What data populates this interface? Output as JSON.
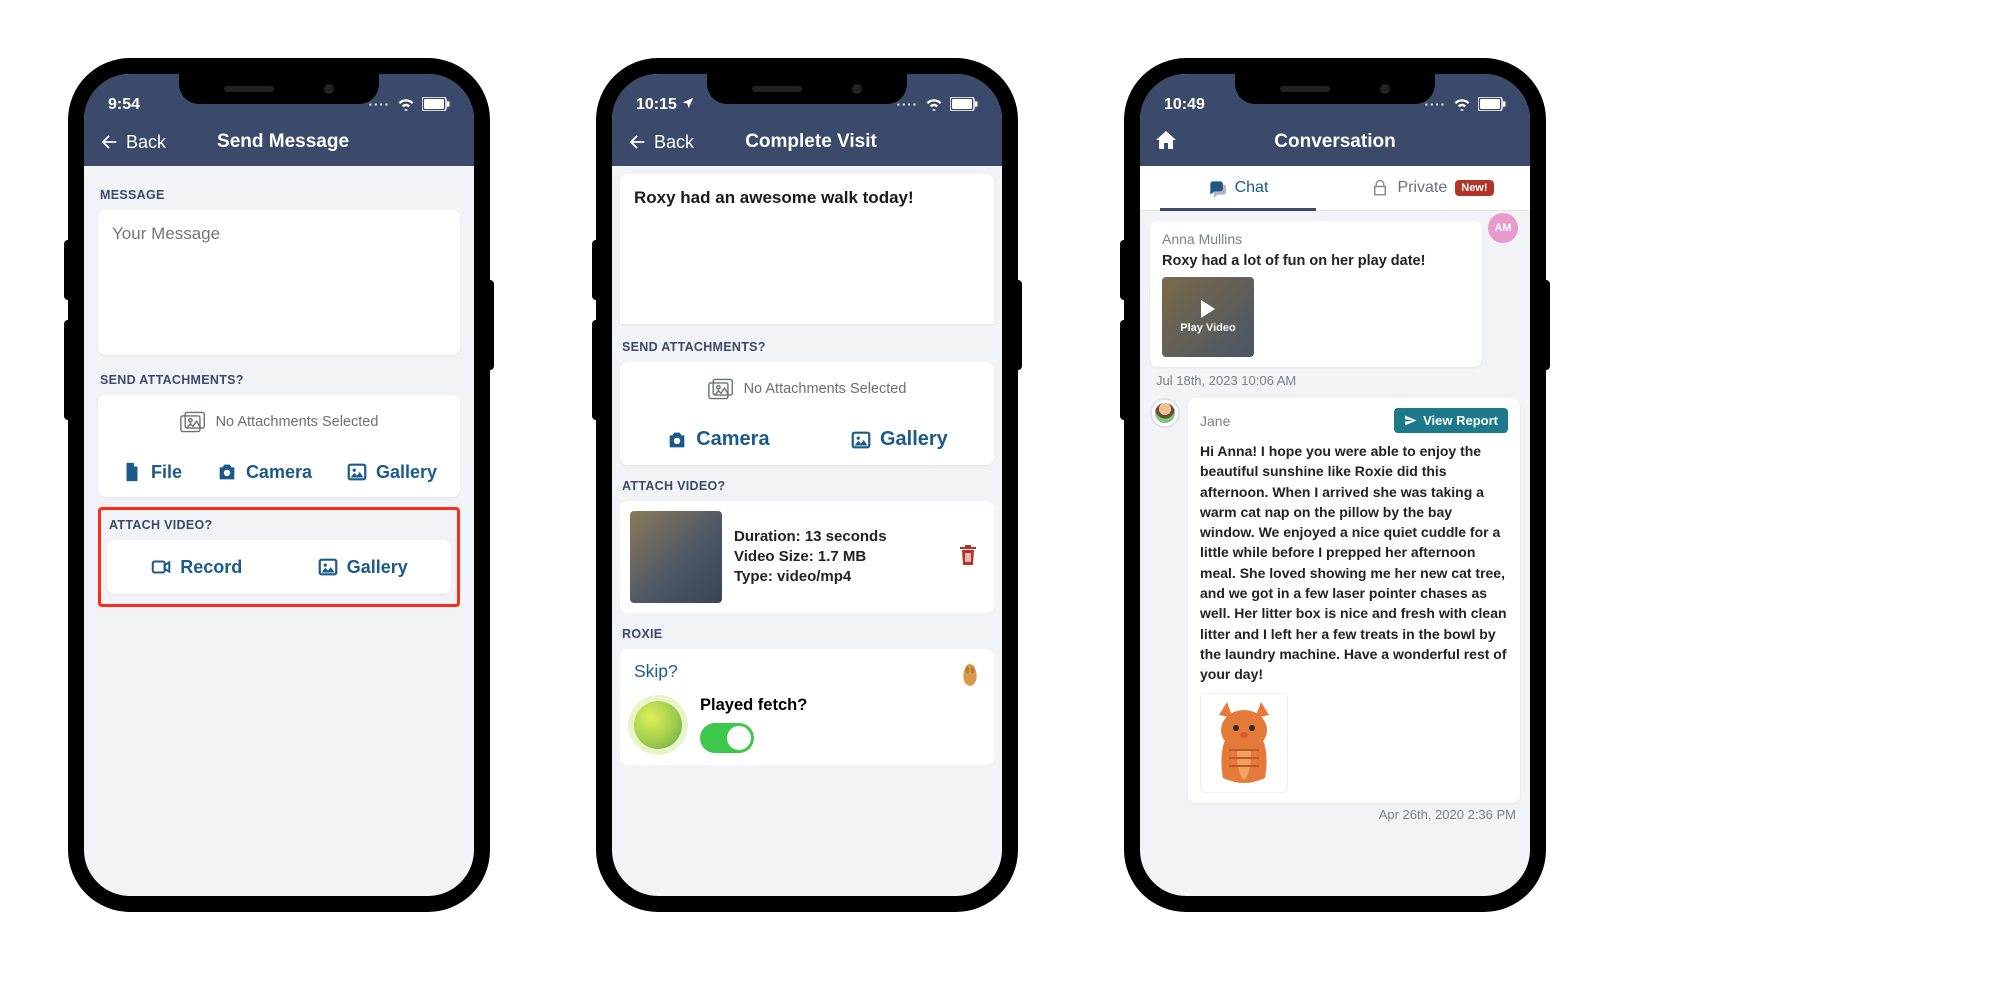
{
  "phone1": {
    "time": "9:54",
    "back": "Back",
    "title": "Send Message",
    "section_message": "MESSAGE",
    "placeholder": "Your Message",
    "section_attach": "SEND ATTACHMENTS?",
    "no_attachments": "No Attachments Selected",
    "file": "File",
    "camera": "Camera",
    "gallery": "Gallery",
    "section_video": "ATTACH VIDEO?",
    "record": "Record",
    "vgallery": "Gallery"
  },
  "phone2": {
    "time": "10:15",
    "back": "Back",
    "title": "Complete Visit",
    "message_text": "Roxy had an awesome walk today!",
    "section_attach": "SEND ATTACHMENTS?",
    "no_attachments": "No Attachments Selected",
    "camera": "Camera",
    "gallery": "Gallery",
    "section_video": "ATTACH VIDEO?",
    "video_duration": "Duration: 13 seconds",
    "video_size": "Video Size: 1.7 MB",
    "video_type": "Type: video/mp4",
    "pet_name": "ROXIE",
    "skip": "Skip?",
    "played_fetch": "Played fetch?"
  },
  "phone3": {
    "time": "10:49",
    "title": "Conversation",
    "tab_chat": "Chat",
    "tab_private": "Private",
    "badge_new": "New!",
    "m1_sender": "Anna Mullins",
    "m1_body": "Roxy had a lot of fun on her play date!",
    "m1_play": "Play Video",
    "m1_ts": "Jul 18th, 2023 10:06 AM",
    "av_initials": "AM",
    "m2_sender": "Jane",
    "view_report": "View Report",
    "m2_body": "Hi Anna! I hope you were able to enjoy the beautiful sunshine like Roxie did this afternoon. When I arrived she was taking a warm cat nap on the pillow by the bay window. We enjoyed a nice quiet cuddle for a little while before I prepped her afternoon meal. She loved showing me her new cat tree, and we got in a few laser pointer chases as well. Her litter box is nice and fresh with clean litter and I left her a few treats in the bowl by the laundry machine. Have a wonderful rest of your day!",
    "m2_ts": "Apr 26th, 2020 2:36 PM"
  }
}
